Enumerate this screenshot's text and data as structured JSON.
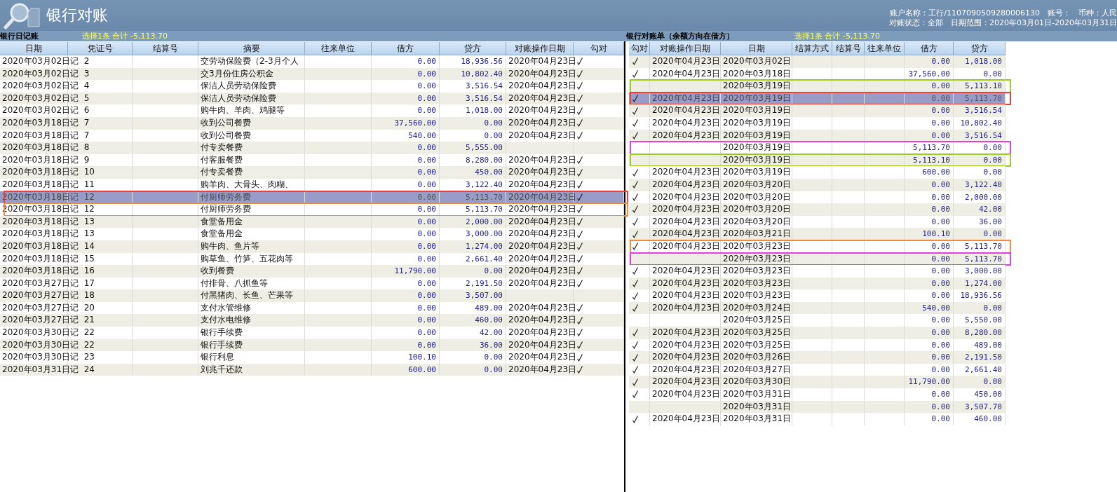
{
  "window": {
    "title": "银行对账",
    "account_line": "账户名称：工行/1107090509280006130　账号：　币种：人民",
    "status_line": "对账状态：全部　日期范围：2020年03月01日-2020年03月31日"
  },
  "journal": {
    "title": "银行日记账",
    "summary": "选择1条 合计 -5,113.70",
    "columns": [
      "日期",
      "凭证号",
      "结算号",
      "摘要",
      "往来单位",
      "借方",
      "贷方",
      "对账操作日期",
      "勾对"
    ],
    "rows": [
      {
        "date": "2020年03月02日",
        "voucher": "记  2",
        "summary": "交劳动保险费（2-3月个人",
        "debit": "0.00",
        "credit": "18,936.56",
        "recon_date": "2020年04月23日",
        "checked": true,
        "selected": false
      },
      {
        "date": "2020年03月02日",
        "voucher": "记  3",
        "summary": "交3月份住房公积金",
        "debit": "0.00",
        "credit": "10,802.40",
        "recon_date": "2020年04月23日",
        "checked": true,
        "selected": false
      },
      {
        "date": "2020年03月02日",
        "voucher": "记  4",
        "summary": "保洁人员劳动保险费",
        "debit": "0.00",
        "credit": "3,516.54",
        "recon_date": "2020年04月23日",
        "checked": true,
        "selected": false
      },
      {
        "date": "2020年03月02日",
        "voucher": "记  5",
        "summary": "保洁人员劳动保险费",
        "debit": "0.00",
        "credit": "3,516.54",
        "recon_date": "2020年04月23日",
        "checked": true,
        "selected": false
      },
      {
        "date": "2020年03月02日",
        "voucher": "记  6",
        "summary": "购牛肉、羊肉、鸡腿等",
        "debit": "0.00",
        "credit": "1,018.00",
        "recon_date": "2020年04月23日",
        "checked": true,
        "selected": false
      },
      {
        "date": "2020年03月18日",
        "voucher": "记  7",
        "summary": "收到公司餐费",
        "debit": "37,560.00",
        "credit": "0.00",
        "recon_date": "2020年04月23日",
        "checked": true,
        "selected": false
      },
      {
        "date": "2020年03月18日",
        "voucher": "记  7",
        "summary": "收到公司餐费",
        "debit": "540.00",
        "credit": "0.00",
        "recon_date": "2020年04月23日",
        "checked": true,
        "selected": false
      },
      {
        "date": "2020年03月18日",
        "voucher": "记  8",
        "summary": "付专卖餐费",
        "debit": "0.00",
        "credit": "5,555.00",
        "checked": false,
        "selected": false
      },
      {
        "date": "2020年03月18日",
        "voucher": "记  9",
        "summary": "付客服餐费",
        "debit": "0.00",
        "credit": "8,280.00",
        "recon_date": "2020年04月23日",
        "checked": true,
        "selected": false
      },
      {
        "date": "2020年03月18日",
        "voucher": "记  10",
        "summary": "付专卖餐费",
        "debit": "0.00",
        "credit": "450.00",
        "recon_date": "2020年04月23日",
        "checked": true,
        "selected": false
      },
      {
        "date": "2020年03月18日",
        "voucher": "记  11",
        "summary": "购羊肉、大骨头、肉糊、",
        "debit": "0.00",
        "credit": "3,122.40",
        "recon_date": "2020年04月23日",
        "checked": true,
        "selected": false
      },
      {
        "date": "2020年03月18日",
        "voucher": "记  12",
        "summary": "付厨师劳务费",
        "debit": "0.00",
        "credit": "5,113.70",
        "recon_date": "2020年04月23日",
        "checked": true,
        "selected": true,
        "color": "#e8413c"
      },
      {
        "date": "2020年03月18日",
        "voucher": "记  12",
        "summary": "付厨师劳务费",
        "debit": "0.00",
        "credit": "5,113.70",
        "recon_date": "2020年04月23日",
        "checked": true,
        "selected": false,
        "color": "#f08a3c"
      },
      {
        "date": "2020年03月18日",
        "voucher": "记  13",
        "summary": "食堂备用金",
        "debit": "0.00",
        "credit": "2,000.00",
        "recon_date": "2020年04月23日",
        "checked": true,
        "selected": false
      },
      {
        "date": "2020年03月18日",
        "voucher": "记  13",
        "summary": "食堂备用金",
        "debit": "0.00",
        "credit": "3,000.00",
        "recon_date": "2020年04月23日",
        "checked": true,
        "selected": false
      },
      {
        "date": "2020年03月18日",
        "voucher": "记  14",
        "summary": "购牛肉、鱼片等",
        "debit": "0.00",
        "credit": "1,274.00",
        "recon_date": "2020年04月23日",
        "checked": true,
        "selected": false
      },
      {
        "date": "2020年03月18日",
        "voucher": "记  15",
        "summary": "购草鱼、竹笋、五花肉等",
        "debit": "0.00",
        "credit": "2,661.40",
        "recon_date": "2020年04月23日",
        "checked": true,
        "selected": false
      },
      {
        "date": "2020年03月18日",
        "voucher": "记  16",
        "summary": "收到餐费",
        "debit": "11,790.00",
        "credit": "0.00",
        "recon_date": "2020年04月23日",
        "checked": true,
        "selected": false
      },
      {
        "date": "2020年03月27日",
        "voucher": "记  17",
        "summary": "付排骨、八抓鱼等",
        "debit": "0.00",
        "credit": "2,191.50",
        "recon_date": "2020年04月23日",
        "checked": true,
        "selected": false
      },
      {
        "date": "2020年03月27日",
        "voucher": "记  18",
        "summary": "付黑猪肉、长鱼、芒果等",
        "debit": "0.00",
        "credit": "3,507.00",
        "checked": false,
        "selected": false
      },
      {
        "date": "2020年03月27日",
        "voucher": "记  20",
        "summary": "支付水管维修",
        "debit": "0.00",
        "credit": "489.00",
        "recon_date": "2020年04月23日",
        "checked": true,
        "selected": false
      },
      {
        "date": "2020年03月27日",
        "voucher": "记  21",
        "summary": "支付水电维修",
        "debit": "0.00",
        "credit": "460.00",
        "recon_date": "2020年04月23日",
        "checked": true,
        "selected": false
      },
      {
        "date": "2020年03月30日",
        "voucher": "记  22",
        "summary": "银行手续费",
        "debit": "0.00",
        "credit": "42.00",
        "recon_date": "2020年04月23日",
        "checked": true,
        "selected": false
      },
      {
        "date": "2020年03月30日",
        "voucher": "记  22",
        "summary": "银行手续费",
        "debit": "0.00",
        "credit": "36.00",
        "recon_date": "2020年04月23日",
        "checked": true,
        "selected": false
      },
      {
        "date": "2020年03月30日",
        "voucher": "记  23",
        "summary": "银行利息",
        "debit": "100.10",
        "credit": "0.00",
        "recon_date": "2020年04月23日",
        "checked": true,
        "selected": false
      },
      {
        "date": "2020年03月31日",
        "voucher": "记  24",
        "summary": "刘兆千还款",
        "debit": "600.00",
        "credit": "0.00",
        "recon_date": "2020年04月23日",
        "checked": true,
        "selected": false
      }
    ]
  },
  "statement": {
    "title": "银行对账单（余额方向在借方）",
    "summary": "选择1条 合计 -5,113.70",
    "columns": [
      "勾对",
      "对账操作日期",
      "日期",
      "结算方式",
      "结算号",
      "往来单位",
      "借方",
      "贷方"
    ],
    "rows": [
      {
        "checked": true,
        "recon_date": "2020年04月23日",
        "date": "2020年03月02日",
        "debit": "0.00",
        "credit": "1,018.00",
        "selected": false
      },
      {
        "checked": true,
        "recon_date": "2020年04月23日",
        "date": "2020年03月18日",
        "debit": "37,560.00",
        "credit": "0.00",
        "selected": false
      },
      {
        "checked": false,
        "date": "2020年03月19日",
        "debit": "0.00",
        "credit": "5,113.10",
        "selected": false,
        "color": "#9ccc1c"
      },
      {
        "checked": true,
        "recon_date": "2020年04月23日",
        "date": "2020年03月19日",
        "debit": "0.00",
        "credit": "5,113.70",
        "selected": true,
        "color": "#e8413c"
      },
      {
        "checked": true,
        "recon_date": "2020年04月23日",
        "date": "2020年03月19日",
        "debit": "0.00",
        "credit": "3,516.54",
        "selected": false
      },
      {
        "checked": true,
        "recon_date": "2020年04月23日",
        "date": "2020年03月19日",
        "debit": "0.00",
        "credit": "10,802.40",
        "selected": false
      },
      {
        "checked": true,
        "recon_date": "2020年04月23日",
        "date": "2020年03月19日",
        "debit": "0.00",
        "credit": "3,516.54",
        "selected": false
      },
      {
        "checked": false,
        "date": "2020年03月19日",
        "debit": "5,113.70",
        "credit": "0.00",
        "selected": false,
        "color": "#e83ce0"
      },
      {
        "checked": false,
        "date": "2020年03月19日",
        "debit": "5,113.10",
        "credit": "0.00",
        "selected": false,
        "color": "#9ccc1c"
      },
      {
        "checked": true,
        "recon_date": "2020年04月23日",
        "date": "2020年03月19日",
        "debit": "600.00",
        "credit": "0.00",
        "selected": false
      },
      {
        "checked": true,
        "recon_date": "2020年04月23日",
        "date": "2020年03月20日",
        "debit": "0.00",
        "credit": "3,122.40",
        "selected": false
      },
      {
        "checked": true,
        "recon_date": "2020年04月23日",
        "date": "2020年03月20日",
        "debit": "0.00",
        "credit": "2,000.00",
        "selected": false
      },
      {
        "checked": true,
        "recon_date": "2020年04月23日",
        "date": "2020年03月20日",
        "debit": "0.00",
        "credit": "42.00",
        "selected": false
      },
      {
        "checked": true,
        "recon_date": "2020年04月23日",
        "date": "2020年03月20日",
        "debit": "0.00",
        "credit": "36.00",
        "selected": false
      },
      {
        "checked": true,
        "recon_date": "2020年04月23日",
        "date": "2020年03月21日",
        "debit": "100.10",
        "credit": "0.00",
        "selected": false
      },
      {
        "checked": true,
        "recon_date": "2020年04月23日",
        "date": "2020年03月23日",
        "debit": "0.00",
        "credit": "5,113.70",
        "selected": false,
        "color": "#f08a3c"
      },
      {
        "checked": false,
        "date": "2020年03月23日",
        "debit": "0.00",
        "credit": "5,113.70",
        "selected": false,
        "color": "#e83ce0"
      },
      {
        "checked": true,
        "recon_date": "2020年04月23日",
        "date": "2020年03月23日",
        "debit": "0.00",
        "credit": "3,000.00",
        "selected": false
      },
      {
        "checked": true,
        "recon_date": "2020年04月23日",
        "date": "2020年03月23日",
        "debit": "0.00",
        "credit": "1,274.00",
        "selected": false
      },
      {
        "checked": true,
        "recon_date": "2020年04月23日",
        "date": "2020年03月23日",
        "debit": "0.00",
        "credit": "18,936.56",
        "selected": false
      },
      {
        "checked": true,
        "recon_date": "2020年04月23日",
        "date": "2020年03月24日",
        "debit": "540.00",
        "credit": "0.00",
        "selected": false
      },
      {
        "checked": false,
        "date": "2020年03月25日",
        "debit": "0.00",
        "credit": "5,550.00",
        "selected": false
      },
      {
        "checked": true,
        "recon_date": "2020年04月23日",
        "date": "2020年03月25日",
        "debit": "0.00",
        "credit": "8,280.00",
        "selected": false
      },
      {
        "checked": true,
        "recon_date": "2020年04月23日",
        "date": "2020年03月25日",
        "debit": "0.00",
        "credit": "489.00",
        "selected": false
      },
      {
        "checked": true,
        "recon_date": "2020年04月23日",
        "date": "2020年03月26日",
        "debit": "0.00",
        "credit": "2,191.50",
        "selected": false
      },
      {
        "checked": true,
        "recon_date": "2020年04月23日",
        "date": "2020年03月27日",
        "debit": "0.00",
        "credit": "2,661.40",
        "selected": false
      },
      {
        "checked": true,
        "recon_date": "2020年04月23日",
        "date": "2020年03月30日",
        "debit": "11,790.00",
        "credit": "0.00",
        "selected": false
      },
      {
        "checked": true,
        "recon_date": "2020年04月23日",
        "date": "2020年03月31日",
        "debit": "0.00",
        "credit": "450.00",
        "selected": false
      },
      {
        "checked": false,
        "date": "2020年03月31日",
        "debit": "0.00",
        "credit": "3,507.70",
        "selected": false
      },
      {
        "checked": true,
        "recon_date": "2020年04月23日",
        "date": "2020年03月31日",
        "debit": "0.00",
        "credit": "460.00",
        "selected": false
      }
    ]
  }
}
